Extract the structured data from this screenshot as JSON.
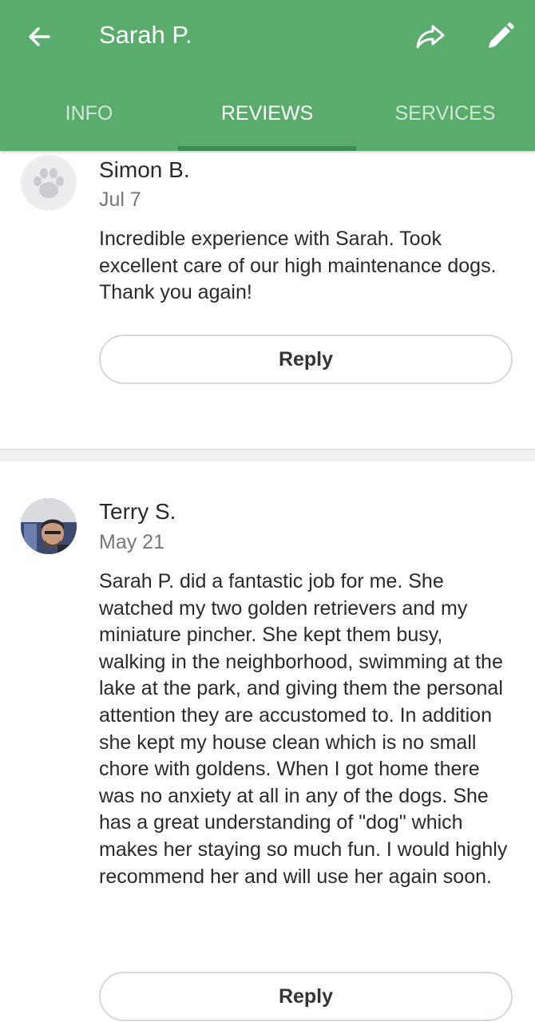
{
  "header": {
    "title": "Sarah P.",
    "accent_color": "#5aac6c",
    "icons": {
      "back": "arrow-left-icon",
      "share": "share-icon",
      "edit": "pencil-icon"
    }
  },
  "tabs": [
    {
      "label": "INFO",
      "active": false
    },
    {
      "label": "REVIEWS",
      "active": true
    },
    {
      "label": "SERVICES",
      "active": false
    }
  ],
  "reviews": [
    {
      "reviewer": "Simon B.",
      "date": "Jul 7",
      "avatar": "paw-icon",
      "text": "Incredible experience with Sarah. Took excellent care of our high maintenance dogs. Thank you again!",
      "reply_label": "Reply"
    },
    {
      "reviewer": "Terry S.",
      "date": "May 21",
      "avatar": "user-photo",
      "text": "Sarah P. did a fantastic job for me. She watched my two golden retrievers and my miniature pincher. She kept them busy, walking in the neighborhood, swimming at the lake at the park, and giving them the personal attention they are accustomed to. In addition she kept my house clean which is no small chore with goldens. When I got home there was no anxiety at all in any of the dogs. She has a great understanding of \"dog\" which makes her staying so much fun. I would highly recommend her and will use her again soon.",
      "reply_label": "Reply"
    }
  ]
}
